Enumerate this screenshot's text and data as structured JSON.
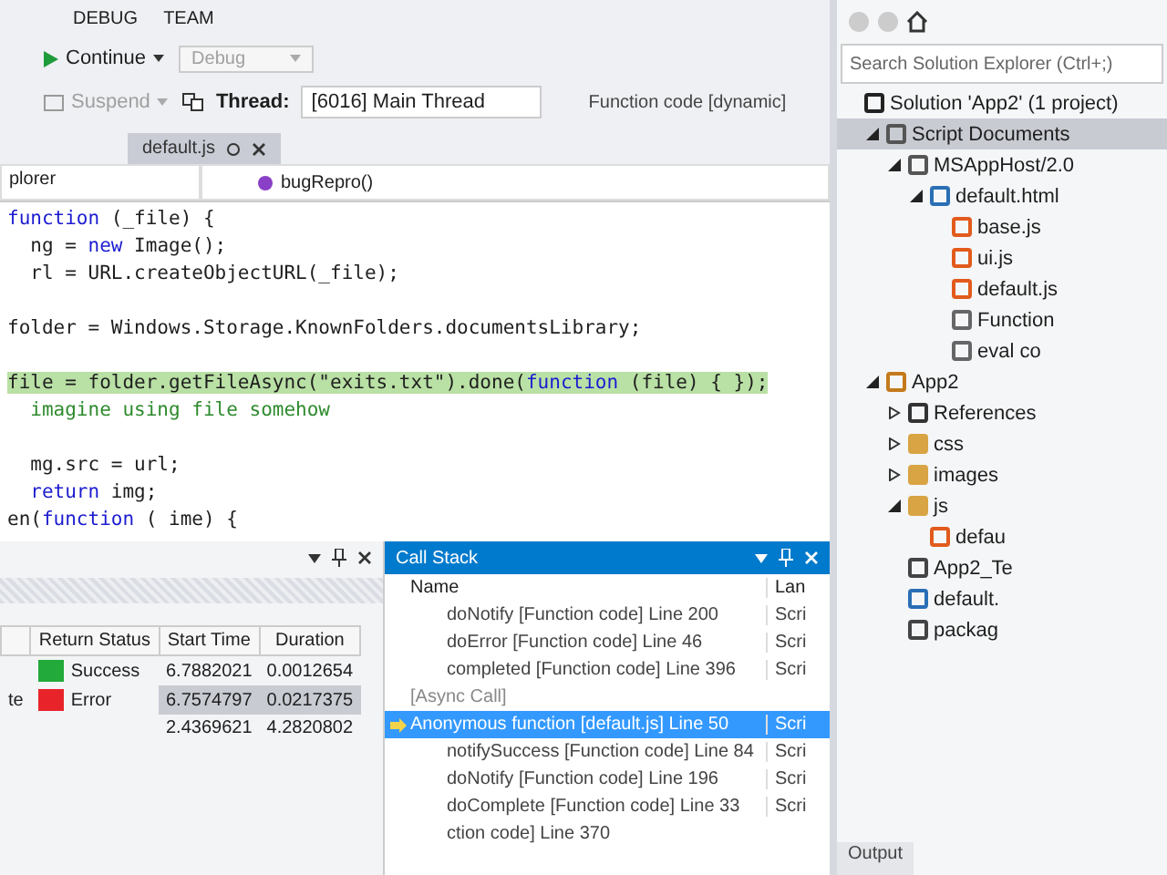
{
  "menu": [
    "DEBUG",
    "TEAM"
  ],
  "toolbar": {
    "continue": "Continue",
    "configuration": {
      "value": "Debug",
      "disabled": true
    },
    "suspend": {
      "label": "Suspend",
      "disabled": true
    },
    "thread_label": "Thread:",
    "thread": "[6016] Main Thread",
    "stack_frame": "Function code [dynamic]"
  },
  "editor": {
    "tabs": [
      {
        "label": "default.js",
        "selected": true
      }
    ],
    "nav_left": "plorer",
    "nav_member": "bugRepro()",
    "lines": [
      {
        "kind": "plain",
        "tokens": [
          {
            "text": "function",
            "kw": true
          },
          {
            "text": " (_file) {",
            "kw": false
          }
        ]
      },
      {
        "kind": "plain",
        "tokens": [
          {
            "text": "  ng = ",
            "kw": false
          },
          {
            "text": "new",
            "kw": true
          },
          {
            "text": " Image();",
            "kw": false
          }
        ]
      },
      {
        "kind": "plain",
        "tokens": [
          {
            "text": "  rl = URL.createObjectURL(_file);",
            "kw": false
          }
        ]
      },
      {
        "kind": "blank"
      },
      {
        "kind": "plain",
        "tokens": [
          {
            "text": "folder = Windows.Storage.KnownFolders.documentsLibrary;",
            "kw": false
          }
        ]
      },
      {
        "kind": "blank"
      },
      {
        "kind": "highlight",
        "tokens": [
          {
            "text": "file = folder.getFileAsync(\"exits.txt\").done(",
            "kw": false
          },
          {
            "text": "function",
            "kw": true
          },
          {
            "text": " (file) { });",
            "kw": false
          }
        ]
      },
      {
        "kind": "comment",
        "tokens": [
          {
            "text": "  imagine using file somehow",
            "kw": false
          }
        ]
      },
      {
        "kind": "blank"
      },
      {
        "kind": "plain",
        "tokens": [
          {
            "text": "  mg.src = url;",
            "kw": false
          }
        ]
      },
      {
        "kind": "plain",
        "tokens": [
          {
            "text": "  return",
            "kw": true
          },
          {
            "text": " img;",
            "kw": false
          }
        ]
      },
      {
        "kind": "plain",
        "tokens": [
          {
            "text": "en(",
            "kw": false
          },
          {
            "text": "function",
            "kw": true
          },
          {
            "text": " ( ime) {",
            "kw": false
          }
        ]
      }
    ]
  },
  "events": {
    "columns": [
      "Return Status",
      "Start Time",
      "Duration"
    ],
    "rows": [
      {
        "column_1": "",
        "status": "Success",
        "color": "#22aa3a",
        "start_time": "6.7882021",
        "duration": "0.0012654",
        "selected": false
      },
      {
        "column_1": "te",
        "status": "Error",
        "color": "#e8242a",
        "start_time": "6.7574797",
        "duration": "0.0217375",
        "selected": true
      },
      {
        "column_1": "",
        "status": "",
        "color": "",
        "start_time": "2.4369621",
        "duration": "4.2820802",
        "selected": false
      }
    ]
  },
  "call_stack": {
    "title": "Call Stack",
    "columns": [
      "Name",
      "Lan"
    ],
    "rows": [
      {
        "kind": "frame",
        "name": "doNotify [Function code] Line 200",
        "language": "Scri",
        "selected": false
      },
      {
        "kind": "frame",
        "name": "doError [Function code] Line 46",
        "language": "Scri",
        "selected": false
      },
      {
        "kind": "frame",
        "name": "completed [Function code] Line 396",
        "language": "Scri",
        "selected": false
      },
      {
        "kind": "async",
        "name": "[Async Call]",
        "language": "",
        "selected": false
      },
      {
        "kind": "current",
        "name": "Anonymous function [default.js] Line 50",
        "language": "Scri",
        "selected": true
      },
      {
        "kind": "frame",
        "name": "notifySuccess [Function code] Line 84",
        "language": "Scri",
        "selected": false
      },
      {
        "kind": "frame",
        "name": "doNotify [Function code] Line 196",
        "language": "Scri",
        "selected": false
      },
      {
        "kind": "frame",
        "name": "doComplete [Function code] Line 33",
        "language": "Scri",
        "selected": false
      },
      {
        "kind": "frame",
        "name": "ction code] Line 370",
        "language": "",
        "selected": false
      }
    ]
  },
  "solution_explorer": {
    "search": {
      "placeholder": "Search Solution Explorer (Ctrl+;)"
    },
    "tree": [
      {
        "label": "Solution 'App2' (1 project)",
        "kind": "solution",
        "selected": false,
        "children": [
          {
            "label": "Script Documents",
            "kind": "scripts",
            "selected": true,
            "expanded": true,
            "children": [
              {
                "label": "MSAppHost/2.0",
                "kind": "host",
                "selected": false,
                "expanded": true,
                "children": [
                  {
                    "label": "default.html",
                    "kind": "html",
                    "selected": false,
                    "expanded": true,
                    "children": [
                      {
                        "label": "base.js",
                        "kind": "js",
                        "selected": false
                      },
                      {
                        "label": "ui.js",
                        "kind": "js",
                        "selected": false
                      },
                      {
                        "label": "default.js",
                        "kind": "js",
                        "selected": false
                      },
                      {
                        "label": "Function",
                        "kind": "doc",
                        "selected": false
                      },
                      {
                        "label": "eval co",
                        "kind": "doc",
                        "selected": false
                      }
                    ]
                  }
                ]
              }
            ]
          },
          {
            "label": "App2",
            "kind": "project",
            "selected": false,
            "expanded": true,
            "children": [
              {
                "label": "References",
                "kind": "refs",
                "selected": false,
                "expanded": false
              },
              {
                "label": "css",
                "kind": "folder",
                "selected": false,
                "expanded": false
              },
              {
                "label": "images",
                "kind": "folder",
                "selected": false,
                "expanded": false
              },
              {
                "label": "js",
                "kind": "folder",
                "selected": false,
                "expanded": true,
                "children": [
                  {
                    "label": "defau",
                    "kind": "js",
                    "selected": false
                  }
                ]
              },
              {
                "label": "App2_Te",
                "kind": "cert",
                "selected": false
              },
              {
                "label": "default.",
                "kind": "html",
                "selected": false
              },
              {
                "label": "packag",
                "kind": "manifest",
                "selected": false
              }
            ]
          }
        ]
      }
    ]
  },
  "bottom_tabs": [
    "Output"
  ]
}
